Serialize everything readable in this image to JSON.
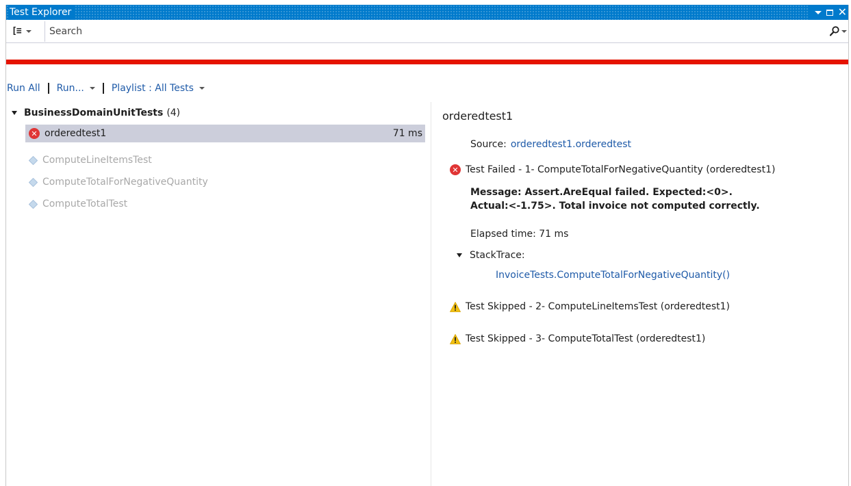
{
  "window": {
    "title": "Test Explorer"
  },
  "search": {
    "placeholder": "Search"
  },
  "colors": {
    "accent": "#007acc",
    "failure_bar": "#e51400",
    "link": "#1e5aa8",
    "selected_row": "#cccedb"
  },
  "icons": {
    "group_by": "group-by-icon",
    "search": "search-icon",
    "failed": "error-icon",
    "not_run": "not-run-icon",
    "skipped": "warning-icon"
  },
  "toolbar": {
    "run_all": "Run All",
    "run": "Run...",
    "playlist": "Playlist : All Tests"
  },
  "tree": {
    "group_name": "BusinessDomainUnitTests",
    "group_count": "(4)",
    "tests": [
      {
        "name": "orderedtest1",
        "duration": "71 ms",
        "status": "failed"
      },
      {
        "name": "ComputeLineItemsTest",
        "duration": "",
        "status": "not-run"
      },
      {
        "name": "ComputeTotalForNegativeQuantity",
        "duration": "",
        "status": "not-run"
      },
      {
        "name": "ComputeTotalTest",
        "duration": "",
        "status": "not-run"
      }
    ]
  },
  "detail": {
    "title": "orderedtest1",
    "source_label": "Source:",
    "source_link": "orderedtest1.orderedtest",
    "failed_text": "Test Failed - 1- ComputeTotalForNegativeQuantity (orderedtest1)",
    "message_line1": "Message: Assert.AreEqual failed. Expected:<0>.",
    "message_line2": "Actual:<-1.75>. Total invoice not computed correctly.",
    "elapsed": "Elapsed time: 71 ms",
    "stacktrace_label": "StackTrace:",
    "stacktrace_link": "InvoiceTests.ComputeTotalForNegativeQuantity()",
    "skipped": [
      "Test Skipped - 2- ComputeLineItemsTest (orderedtest1)",
      "Test Skipped - 3- ComputeTotalTest (orderedtest1)"
    ]
  }
}
